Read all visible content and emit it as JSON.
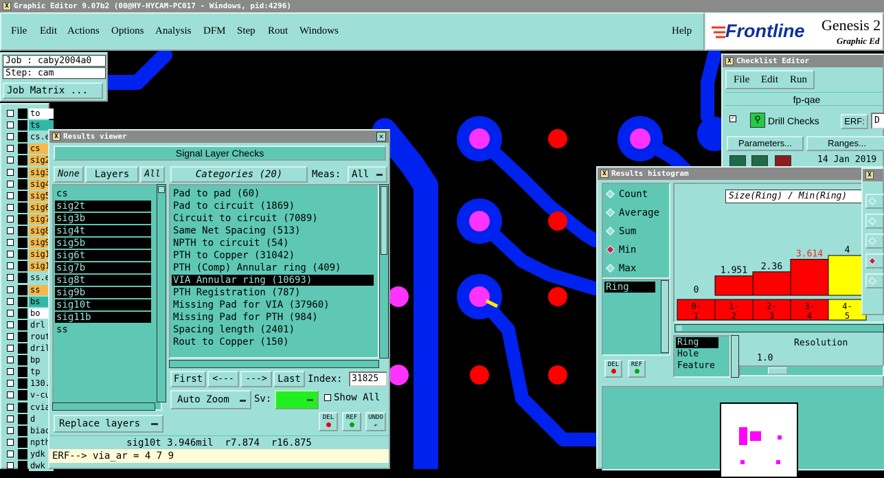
{
  "app": {
    "title": "Graphic Editor 9.07b2 (00@HY-HYCAM-PC017 - Windows, pid:4296)"
  },
  "menu": {
    "items": [
      "File",
      "Edit",
      "Actions",
      "Options",
      "Analysis",
      "DFM",
      "Step",
      "Rout",
      "Windows"
    ],
    "help": "Help"
  },
  "brand": {
    "logo": "Frontline",
    "product": "Genesis 2",
    "subtitle": "Graphic Ed"
  },
  "job": {
    "job_label": "Job : caby2004a0",
    "step_label": "Step: cam",
    "matrix_button": "Job Matrix ..."
  },
  "layer_column": {
    "rows": [
      {
        "name": "to",
        "color": "#ffffff"
      },
      {
        "name": "ts",
        "color": "#33b8a8"
      },
      {
        "name": "cs.e",
        "color": "#9ee0d8"
      },
      {
        "name": "cs",
        "color": "#f5b94a"
      },
      {
        "name": "sig2",
        "color": "#f5b94a"
      },
      {
        "name": "sig3",
        "color": "#f5b94a"
      },
      {
        "name": "sig4",
        "color": "#f5b94a"
      },
      {
        "name": "sig5",
        "color": "#f5b94a"
      },
      {
        "name": "sig6",
        "color": "#f5b94a"
      },
      {
        "name": "sig7",
        "color": "#f5b94a"
      },
      {
        "name": "sig8",
        "color": "#f5b94a"
      },
      {
        "name": "sig9",
        "color": "#f5b94a"
      },
      {
        "name": "sig1",
        "color": "#f5b94a"
      },
      {
        "name": "sig1",
        "color": "#f5b94a"
      },
      {
        "name": "ss.e",
        "color": "#9ee0d8"
      },
      {
        "name": "ss",
        "color": "#f5b94a"
      },
      {
        "name": "bs",
        "color": "#33b8a8"
      },
      {
        "name": "bo",
        "color": "#ffffff"
      },
      {
        "name": "drl",
        "color": "#9ee0d8"
      },
      {
        "name": "rout",
        "color": "#9ee0d8"
      },
      {
        "name": "dril",
        "color": "#9ee0d8"
      },
      {
        "name": "bp",
        "color": "#9ee0d8"
      },
      {
        "name": "tp",
        "color": "#9ee0d8"
      },
      {
        "name": "130.",
        "color": "#9ee0d8"
      },
      {
        "name": "v-cu",
        "color": "#9ee0d8"
      },
      {
        "name": "cvia",
        "color": "#9ee0d8"
      },
      {
        "name": "d",
        "color": "#9ee0d8"
      },
      {
        "name": "biac",
        "color": "#9ee0d8"
      },
      {
        "name": "npth",
        "color": "#9ee0d8"
      },
      {
        "name": "ydk",
        "color": "#9ee0d8"
      },
      {
        "name": "dwk",
        "color": "#9ee0d8"
      }
    ]
  },
  "results_viewer": {
    "title": "Results viewer",
    "header": "Signal Layer Checks",
    "none_btn": "None",
    "layers_btn": "Layers",
    "all_btn": "All",
    "categories_btn": "Categories (20)",
    "meas_label": "Meas:",
    "meas_value": "All",
    "layers": [
      "cs",
      "sig2t",
      "sig3b",
      "sig4t",
      "sig5b",
      "sig6t",
      "sig7b",
      "sig8t",
      "sig9b",
      "sig10t",
      "sig11b",
      "ss"
    ],
    "layers_highlight": [
      false,
      true,
      true,
      true,
      true,
      true,
      true,
      true,
      true,
      true,
      true,
      false
    ],
    "categories": [
      "Pad to pad (60)",
      "Pad to circuit (1869)",
      "Circuit to circuit (7089)",
      "Same Net Spacing (513)",
      "NPTH to circuit (54)",
      "PTH to Copper (31042)",
      "PTH (Comp) Annular ring (409)",
      "VIA Annular ring (10693)",
      "PTH Registration (787)",
      "Missing Pad for VIA (37960)",
      "Missing Pad for PTH (984)",
      "Spacing length (2401)",
      "Rout to Copper (150)"
    ],
    "selected_category": 7,
    "first_btn": "First",
    "prev_btn": "<---",
    "next_btn": "--->",
    "last_btn": "Last",
    "index_label": "Index:",
    "index_value": "31825",
    "replace_btn": "Replace layers",
    "zoom_btn": "Auto Zoom",
    "sv_label": "Sv:",
    "show_all": "Show All",
    "del_btn": "DEL",
    "ref_btn": "REF",
    "undo_btn": "UNDO",
    "status": "sig10t 3.946mil  r7.874  r16.875",
    "erf": "ERF--> via_ar = 4 7 9"
  },
  "checklist": {
    "title": "Checklist Editor",
    "menu": [
      "File",
      "Edit",
      "Run"
    ],
    "name": "fp-qae",
    "drill_checks": "Drill Checks",
    "erf_label": "ERF:",
    "erf_value": "D",
    "parameters_btn": "Parameters...",
    "ranges_btn": "Ranges...",
    "date": "14 Jan 2019"
  },
  "histogram": {
    "title": "Results histogram",
    "radio_options": [
      "Count",
      "Average",
      "Sum",
      "Min",
      "Max"
    ],
    "selected_radio": 3,
    "list_selected": "Ring",
    "chart_title": "Size(Ring) / Min(Ring)",
    "bars": [
      {
        "label": "0",
        "bin": "0- 1",
        "value": 0,
        "color": "#ff0000"
      },
      {
        "label": "1.951",
        "bin": "1- 2",
        "value": 1.951,
        "color": "#ff0000"
      },
      {
        "label": "2.36",
        "bin": "2- 3",
        "value": 2.36,
        "color": "#ff0000"
      },
      {
        "label": "3.614",
        "bin": "3- 4",
        "value": 3.614,
        "color": "#ff0000"
      },
      {
        "label": "4",
        "bin": "4- 5",
        "value": 4,
        "color": "#ffff00"
      }
    ],
    "highlight_label": 3,
    "size_options": [
      "Ring",
      "Hole",
      "Feature"
    ],
    "resolution_label": "Resolution",
    "resolution_value": "1.0",
    "del_btn": "DEL",
    "ref_btn": "REF"
  },
  "colors": {
    "teal": "#9ee0d8",
    "copper": "#0022ee",
    "via": "#ff33ff",
    "drill": "#ff0000"
  }
}
